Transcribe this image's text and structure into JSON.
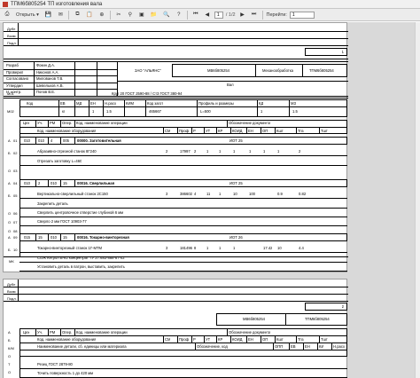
{
  "window": {
    "title": "ТПМ6б805254 ТП изготовления вала"
  },
  "toolbar": {
    "open_label": "Открыть",
    "page_current": "1",
    "page_sep": "/ 1/2",
    "goto_label": "Перейти:",
    "goto_value": "1"
  },
  "left_labels": {
    "dubl": "Дубл",
    "vzam": "Взам.",
    "podl": "Подл."
  },
  "page1": {
    "number": "1",
    "people": [
      {
        "role": "Разраб",
        "name": "Фокин Д.А."
      },
      {
        "role": "Проверил",
        "name": "Никонов А.А."
      },
      {
        "role": "Согласовано",
        "name": "Милованов Т.В."
      },
      {
        "role": "Утвердил",
        "name": "Шевельков А.В."
      },
      {
        "role": "Н. контр.",
        "name": "Попов В.Е."
      }
    ],
    "org": "ЗАО \"АЛЬЯНС\"",
    "doc_code": "МВ6б805254",
    "dept": "Механообработка",
    "doc_code2": "ТПМ6б805254",
    "part_name": "Вал",
    "m01_label": "М01",
    "m01_text": "Круг 20  ГОСТ 2590-88 / Ст3  ГОСТ 380-94",
    "m02_label": "М02",
    "header_cols": [
      "Код",
      "ЕВ",
      "МД",
      "ЕН",
      "Н.расх",
      "КИМ",
      "Код загот",
      "Профиль и размеры",
      "КД",
      "МЗ"
    ],
    "m02_values": [
      "",
      "кг",
      "",
      "1",
      "1.5",
      "",
      "465667",
      "L=500",
      "1",
      "1.5"
    ],
    "op_header_a": [
      "Цех",
      "Уч.",
      "РМ",
      "Опер.",
      "Код, наименование операции",
      "Обозначение документа"
    ],
    "op_header_b": [
      "Код, наименование оборудования",
      "СМ",
      "Проф",
      "Р",
      "УТ",
      "КР",
      "КОИД",
      "ЕН",
      "ОП",
      "Кшт",
      "Тпз",
      "Тшт"
    ],
    "operations": [
      {
        "a": [
          "010",
          "010",
          "4",
          "005"
        ],
        "name": "00000. Заготовительная",
        "doc": "ИОТ 25",
        "equip": "Абразивно-отрезной станок 8Г240",
        "params": [
          "2",
          "17997",
          "2",
          "1",
          "1",
          "1",
          "1",
          "1",
          "1",
          "2"
        ],
        "notes": [
          "Отрезать заготовку L=460"
        ]
      },
      {
        "a": [
          "010",
          "2",
          "010",
          "15"
        ],
        "name": "00016. Сверлильная",
        "doc": "ИОТ 25",
        "equip": "Вертикально-сверлильный станок 2С150",
        "params": [
          "3",
          "386602",
          "4",
          "11",
          "1",
          "10",
          "100",
          "",
          "0.9",
          "0.82"
        ],
        "notes": [
          "Закрепить деталь",
          "Сверлить  центровочное отверстие  глубиной 6 мм",
          "Сверло 2 мм   ГОСТ 10903-77"
        ]
      },
      {
        "a": [
          "015",
          "15",
          "010",
          "15"
        ],
        "name": "00016. Токарно-винторезная",
        "doc": "ИОТ 26",
        "equip": "Токарно-винторезный станок 1Г-МТМ",
        "params": [
          "3",
          "181496",
          "8",
          "1",
          "1",
          "1",
          "",
          "17.42",
          "10",
          "4.4"
        ],
        "notes": [
          "СОЖ Кетрол В-н2 концентрат ТУ 27.683-888-87-02",
          "Установить деталь в патрон, выставить, закрепить"
        ]
      }
    ],
    "row_letters": [
      "А",
      "Б",
      "О",
      "А",
      "Б",
      "О",
      "О",
      "О",
      "А",
      "Б",
      "О",
      "О"
    ],
    "row_nums": [
      "01",
      "02",
      "03",
      "04",
      "05",
      "06",
      "07",
      "08",
      "09",
      "10",
      "11",
      "12",
      "13",
      "14",
      "15"
    ],
    "mk": "МК"
  },
  "page2": {
    "number": "2",
    "doc_code": "МВ6б805254",
    "doc_code2": "ТПМ6б805254",
    "hdr_a": [
      "Цех",
      "Уч.",
      "РМ",
      "Опер.",
      "Код, наименование операции",
      "Обозначение документа"
    ],
    "hdr_b": [
      "Код, наименование оборудования",
      "СМ",
      "Проф",
      "Р",
      "УТ",
      "КР",
      "КОИД",
      "ЕН",
      "ОП",
      "Кшт",
      "Тпз",
      "Тшт"
    ],
    "hdr_c": [
      "Наименование детали, сб. единицы или материала",
      "Обозначение, код",
      "ОПП",
      "ЕВ",
      "ЕН",
      "КИ",
      "Н.расх"
    ],
    "rows": [
      "Резец   ГОСТ 2879-80",
      "Точить поверхность 1 до 420 мм"
    ],
    "row_letters": [
      "А",
      "Б",
      "К/М",
      "О",
      "Т",
      "О",
      "Т",
      "О"
    ]
  }
}
